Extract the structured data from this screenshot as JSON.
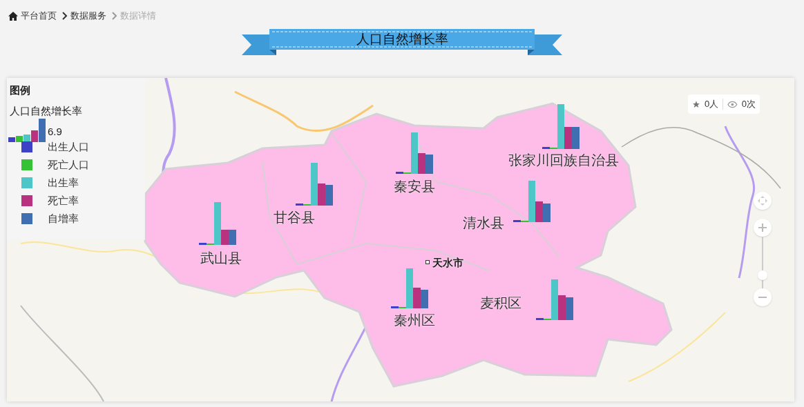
{
  "breadcrumb": [
    {
      "label": "平台首页",
      "current": false
    },
    {
      "label": "数据服务",
      "current": false
    },
    {
      "label": "数据详情",
      "current": true
    }
  ],
  "title": "人口自然增长率",
  "legend": {
    "title": "图例",
    "subtitle": "人口自然增长率",
    "value": "6.9",
    "items": [
      {
        "label": "出生人口",
        "color": "#3c41c8"
      },
      {
        "label": "死亡人口",
        "color": "#35c235"
      },
      {
        "label": "出生率",
        "color": "#4cc6c6"
      },
      {
        "label": "死亡率",
        "color": "#b8327f"
      },
      {
        "label": "自增率",
        "color": "#3f6fb0"
      }
    ]
  },
  "stats": {
    "favorites": "0人",
    "views": "0次"
  },
  "map": {
    "city": "天水市",
    "places": [
      {
        "name": "武山县"
      },
      {
        "name": "甘谷县"
      },
      {
        "name": "秦安县"
      },
      {
        "name": "清水县"
      },
      {
        "name": "张家川回族自治县"
      },
      {
        "name": "秦州区"
      },
      {
        "name": "麦积区"
      }
    ],
    "zoom": {
      "level": 0.25
    }
  }
}
